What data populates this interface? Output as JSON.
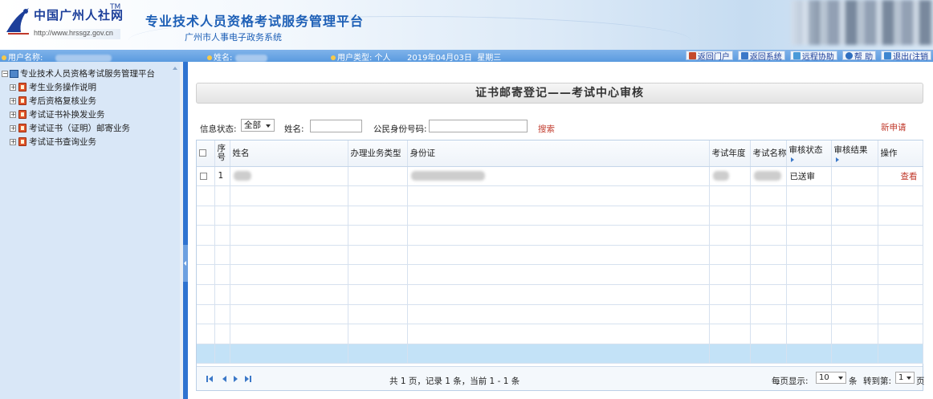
{
  "header": {
    "logo_text": "中国广州人社网",
    "logo_tm": "TM",
    "logo_url": "http://www.hrssgz.gov.cn",
    "title": "专业技术人员资格考试服务管理平台",
    "subtitle": "广州市人事电子政务系统"
  },
  "infobar": {
    "user_name_label": "用户名称:",
    "name_label": "姓名:",
    "user_type_label": "用户类型: 个人",
    "date": "2019年04月03日",
    "weekday": "星期三",
    "nav": [
      {
        "label": "返回门户",
        "icon": "home-icon",
        "color": "#c44a2c"
      },
      {
        "label": "返回系统",
        "icon": "monitor-icon",
        "color": "#3b78c8"
      },
      {
        "label": "远程协助",
        "icon": "remote-icon",
        "color": "#4a9ad8"
      },
      {
        "label": "帮 助",
        "icon": "help-icon",
        "color": "#2f6fc0"
      },
      {
        "label": "退出(注销",
        "icon": "exit-icon",
        "color": "#3d86d0"
      }
    ]
  },
  "sidebar": {
    "root": "专业技术人员资格考试服务管理平台",
    "items": [
      {
        "label": "考生业务操作说明"
      },
      {
        "label": "考后资格复核业务"
      },
      {
        "label": "考试证书补换发业务"
      },
      {
        "label": "考试证书（证明）邮寄业务"
      },
      {
        "label": "考试证书查询业务"
      }
    ]
  },
  "main": {
    "title": "证书邮寄登记——考试中心审核",
    "filters": {
      "status_label": "信息状态:",
      "status_value": "全部",
      "name_label": "姓名:",
      "id_label": "公民身份号码:",
      "search": "搜索",
      "new_request": "新申请"
    },
    "columns": {
      "index_top": "序",
      "index_bottom": "号",
      "name": "姓名",
      "biz_type": "办理业务类型",
      "id_card": "身份证",
      "year": "考试年度",
      "exam_name": "考试名称",
      "review_status": "审核状态",
      "review_result": "审核结果",
      "action": "操作"
    },
    "rows": [
      {
        "index": "1",
        "review_status": "已送审",
        "action": "查看"
      }
    ],
    "pager": {
      "summary": "共 1 页，记录 1 条，当前 1 - 1 条",
      "per_page_label": "每页显示:",
      "per_page_value": "10",
      "per_page_unit": "条",
      "goto_label": "转到第:",
      "goto_value": "1",
      "goto_unit": "页"
    }
  }
}
